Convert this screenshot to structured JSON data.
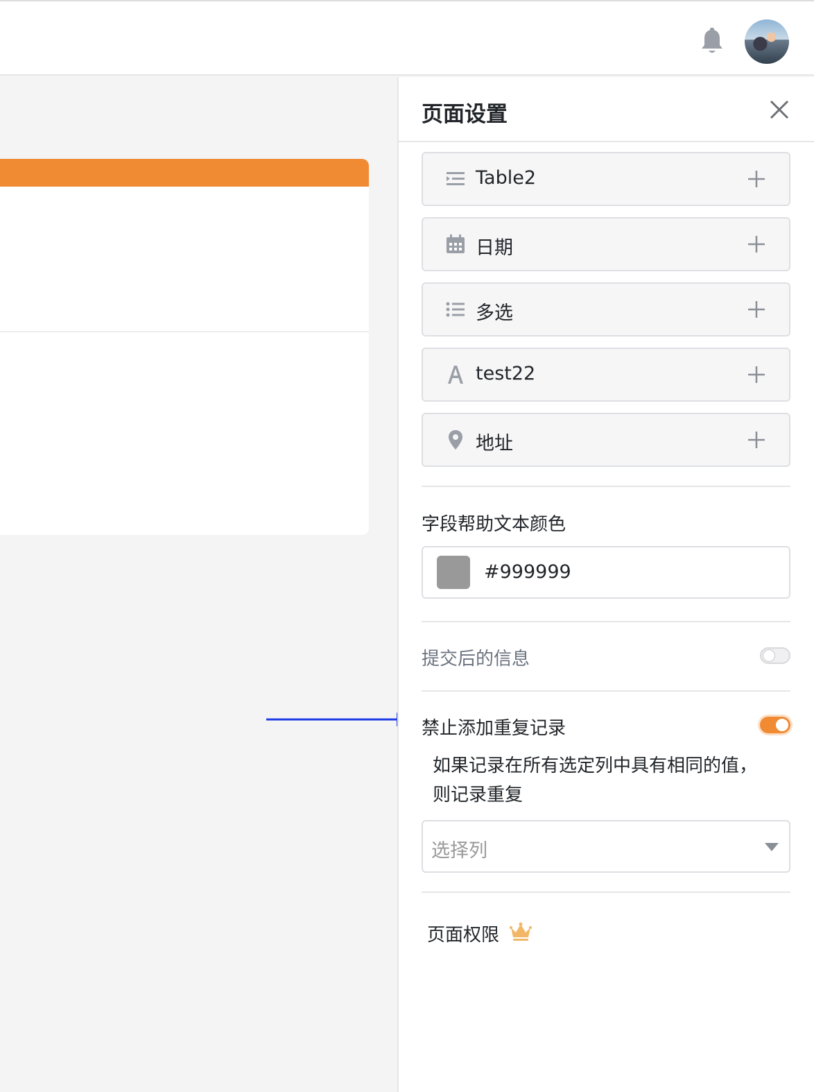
{
  "header": {
    "bell_icon": "bell-icon",
    "avatar_icon": "avatar"
  },
  "panel": {
    "title": "页面设置",
    "fields": [
      {
        "icon": "text-list-icon",
        "label": "Table2"
      },
      {
        "icon": "calendar-icon",
        "label": "日期"
      },
      {
        "icon": "bullet-list-icon",
        "label": "多选"
      },
      {
        "icon": "text-a-icon",
        "label": "test22"
      },
      {
        "icon": "map-pin-icon",
        "label": "地址"
      }
    ],
    "help_color": {
      "label": "字段帮助文本颜色",
      "value": "#999999",
      "swatch_color": "#999999"
    },
    "submit_message": {
      "label": "提交后的信息",
      "enabled": false
    },
    "prevent_duplicates": {
      "label": "禁止添加重复记录",
      "enabled": true,
      "description": "如果记录在所有选定列中具有相同的值，则记录重复",
      "select_placeholder": "选择列"
    },
    "page_permissions": {
      "label": "页面权限",
      "badge_icon": "crown-icon"
    }
  },
  "colors": {
    "accent": "#f08a33",
    "arrow": "#1f3de8",
    "muted_text": "#6b7380"
  }
}
